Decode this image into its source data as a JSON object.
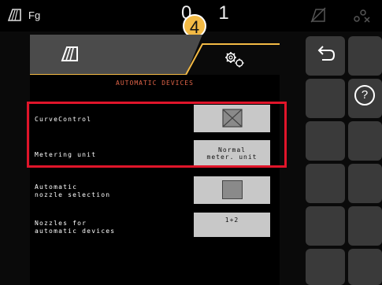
{
  "topbar": {
    "app_label": "Fg",
    "time_fragment": "0",
    "time_fragment_right": "1",
    "callout_number": "4"
  },
  "settings_panel": {
    "title": "AUTOMATIC DEVICES",
    "rows": [
      {
        "label": "CurveControl",
        "value": ""
      },
      {
        "label": "Metering unit",
        "value_line1": "Normal",
        "value_line2": "meter. unit"
      },
      {
        "label_line1": "Automatic",
        "label_line2": "nozzle selection"
      },
      {
        "label_line1": "Nozzles for",
        "label_line2": "automatic devices",
        "value": "1+2"
      }
    ]
  },
  "side_panel": {
    "help_symbol": "?"
  },
  "colors": {
    "title_accent": "#e06448",
    "tab_border": "#f3ba45",
    "highlight": "#e0152a"
  }
}
